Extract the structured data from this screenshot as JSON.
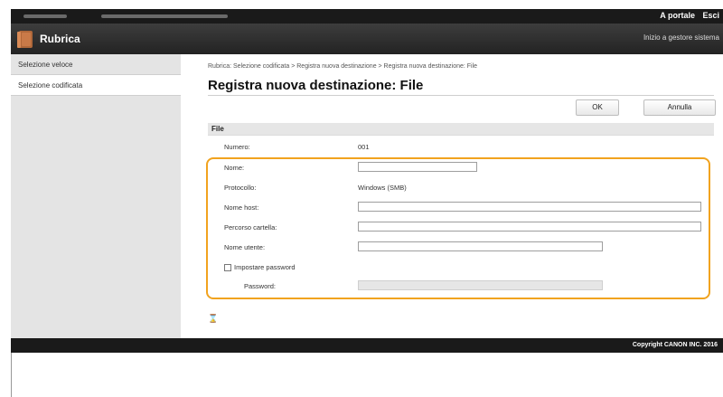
{
  "topbar": {
    "links": [
      "A portale",
      "Esci"
    ]
  },
  "app": {
    "title": "Rubrica",
    "portal_link": "Inizio a gestore sistema"
  },
  "sidebar": {
    "items": [
      {
        "label": "Selezione veloce"
      },
      {
        "label": "Selezione codificata"
      }
    ]
  },
  "main": {
    "breadcrumb": "Rubrica: Selezione codificata > Registra nuova destinazione > Registra nuova destinazione: File",
    "heading": "Registra nuova destinazione: File",
    "ok_label": "OK",
    "cancel_label": "Annulla",
    "panel_title": "File",
    "fields": {
      "numero_label": "Numero:",
      "numero_value": "001",
      "nome_label": "Nome:",
      "nome_value": "",
      "protocollo_label": "Protocollo:",
      "protocollo_value": "Windows (SMB)",
      "host_label": "Nome host:",
      "host_value": "",
      "percorso_label": "Percorso cartella:",
      "percorso_value": "",
      "utente_label": "Nome utente:",
      "utente_value": "",
      "impostare_password_label": "Impostare password",
      "password_label": "Password:",
      "password_value": ""
    },
    "pin_glyph": "⌛"
  },
  "footer": {
    "copyright": "Copyright CANON INC. 2016"
  },
  "colors": {
    "highlight": "#f1a31f",
    "bar": "#1a1a1a"
  }
}
